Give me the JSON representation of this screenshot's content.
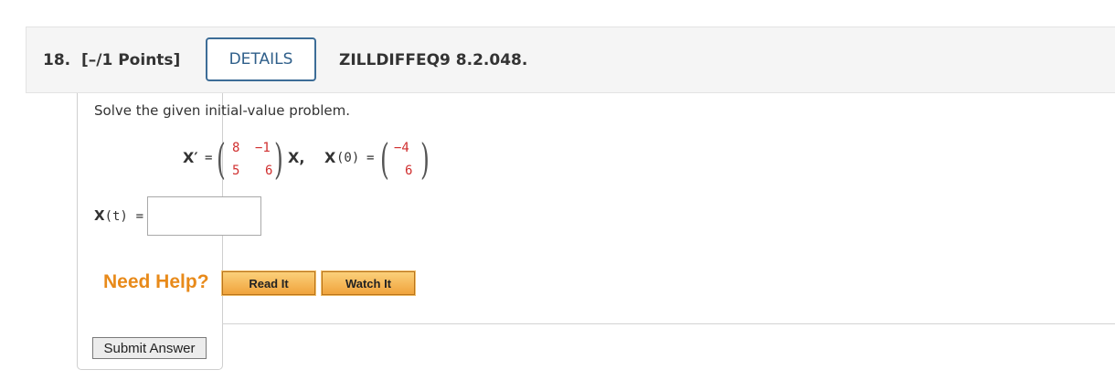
{
  "header": {
    "question_number": "18.",
    "points": "[–/1 Points]",
    "details_label": "DETAILS",
    "question_id": "ZILLDIFFEQ9 8.2.048."
  },
  "problem": {
    "prompt": "Solve the given initial-value problem.",
    "lhs": "X′",
    "equals": "=",
    "matrix": [
      [
        "8",
        "−1"
      ],
      [
        "5",
        "6"
      ]
    ],
    "rhs_var": "X,",
    "ic_label": "X",
    "ic_arg": "(0)",
    "ic_vector": [
      "−4",
      "6"
    ]
  },
  "answer": {
    "label_var": "X",
    "label_arg": "(t)",
    "label_eq": "=",
    "value": "",
    "placeholder": ""
  },
  "help": {
    "need_help": "Need Help?",
    "read_it": "Read It",
    "watch_it": "Watch It"
  },
  "submit_label": "Submit Answer",
  "colors": {
    "details_border": "#3d6d97",
    "need_help": "#e88a1a",
    "matrix_entries": "#d03030"
  }
}
